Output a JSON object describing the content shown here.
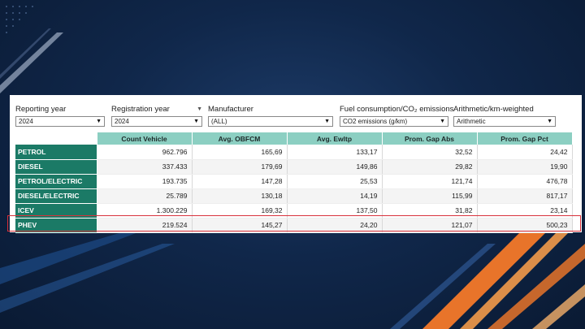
{
  "filters": [
    {
      "label": "Reporting year",
      "value": "2024",
      "sortable": false
    },
    {
      "label": "Registration year",
      "value": "2024",
      "sortable": true
    },
    {
      "label": "Manufacturer",
      "value": "(ALL)",
      "sortable": false
    },
    {
      "label": "Fuel consumption/CO₂ emissions",
      "value": "CO2 emissions (g/km)",
      "sortable": false
    },
    {
      "label": "Arithmetic/km-weighted",
      "value": "Arithmetic",
      "sortable": false
    }
  ],
  "table": {
    "columns": [
      "Count Vehicle",
      "Avg. OBFCM",
      "Avg. Ewltp",
      "Prom. Gap Abs",
      "Prom. Gap Pct"
    ],
    "rows": [
      {
        "label": "PETROL",
        "values": [
          "962.796",
          "165,69",
          "133,17",
          "32,52",
          "24,42"
        ]
      },
      {
        "label": "DIESEL",
        "values": [
          "337.433",
          "179,69",
          "149,86",
          "29,82",
          "19,90"
        ]
      },
      {
        "label": "PETROL/ELECTRIC",
        "values": [
          "193.735",
          "147,28",
          "25,53",
          "121,74",
          "476,78"
        ]
      },
      {
        "label": "DIESEL/ELECTRIC",
        "values": [
          "25.789",
          "130,18",
          "14,19",
          "115,99",
          "817,17"
        ]
      },
      {
        "label": "ICEV",
        "values": [
          "1.300.229",
          "169,32",
          "137,50",
          "31,82",
          "23,14"
        ]
      },
      {
        "label": "PHEV",
        "values": [
          "219.524",
          "145,27",
          "24,20",
          "121,07",
          "500,23"
        ]
      }
    ],
    "highlighted_row": "PHEV"
  },
  "colors": {
    "row_header": "#1b7a66",
    "column_header": "#8ccfc2",
    "highlight_border": "#d8313b",
    "accent_orange": "#e8742a"
  },
  "icons": {
    "dropdown": "caret-down-icon",
    "sort": "sort-down-icon"
  }
}
